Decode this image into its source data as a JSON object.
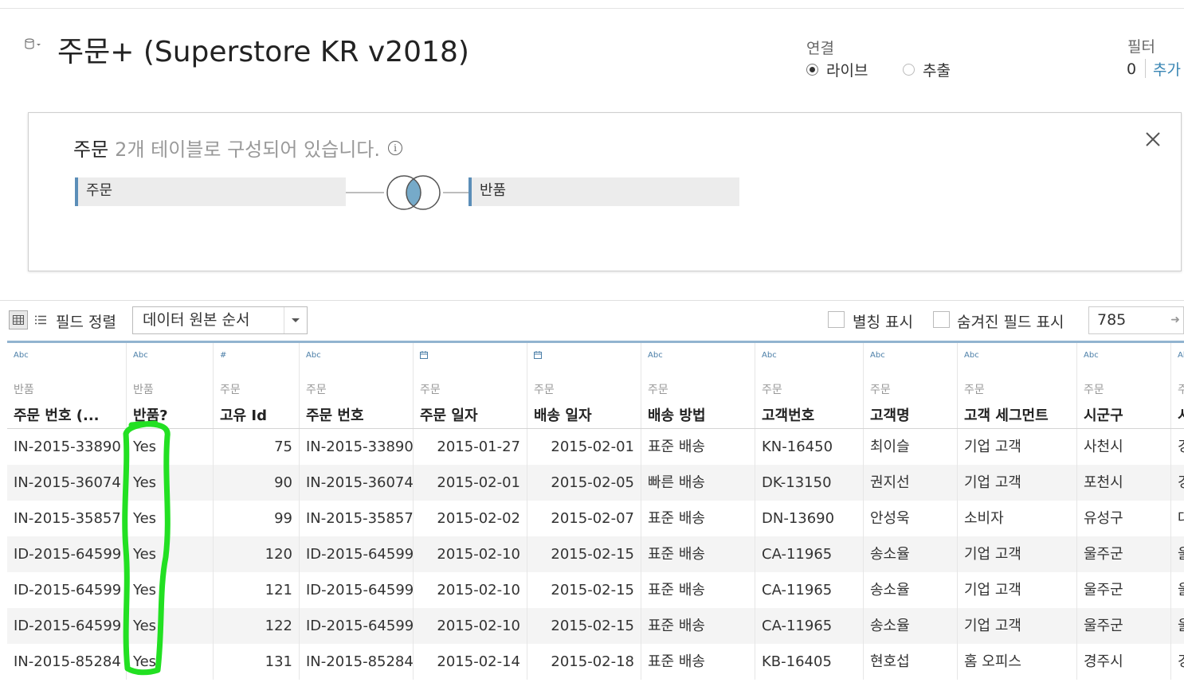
{
  "datasource": {
    "title": "주문+ (Superstore KR v2018)"
  },
  "connection": {
    "label": "연결",
    "live": "라이브",
    "extract": "추출",
    "selected": "live"
  },
  "filters": {
    "label": "필터",
    "count": "0",
    "add": "추가"
  },
  "join_panel": {
    "table_name": "주문",
    "description": "2개 테이블로 구성되어 있습니다.",
    "left_table": "주문",
    "right_table": "반품",
    "join_type": "inner"
  },
  "toolbar": {
    "sort_label": "필드 정렬",
    "sort_value": "데이터 원본 순서",
    "alias_label": "별칭 표시",
    "hidden_label": "숨겨진 필드 표시",
    "row_count": "785"
  },
  "grid": {
    "columns": [
      {
        "type": "Abc",
        "source": "반품",
        "name": "주문 번호 (..."
      },
      {
        "type": "Abc",
        "source": "반품",
        "name": "반품?"
      },
      {
        "type": "#",
        "source": "주문",
        "name": "고유 Id"
      },
      {
        "type": "Abc",
        "source": "주문",
        "name": "주문 번호"
      },
      {
        "type": "date",
        "source": "주문",
        "name": "주문 일자"
      },
      {
        "type": "date",
        "source": "주문",
        "name": "배송 일자"
      },
      {
        "type": "Abc",
        "source": "주문",
        "name": "배송 방법"
      },
      {
        "type": "Abc",
        "source": "주문",
        "name": "고객번호"
      },
      {
        "type": "Abc",
        "source": "주문",
        "name": "고객명"
      },
      {
        "type": "Abc",
        "source": "주문",
        "name": "고객 세그먼트"
      },
      {
        "type": "Abc",
        "source": "주문",
        "name": "시군구"
      },
      {
        "type": "Abc",
        "source": "주",
        "name": "시"
      }
    ],
    "rows": [
      [
        "IN-2015-33890",
        "Yes",
        "75",
        "IN-2015-33890",
        "2015-01-27",
        "2015-02-01",
        "표준 배송",
        "KN-16450",
        "최이슬",
        "기업 고객",
        "사천시",
        "경"
      ],
      [
        "IN-2015-36074",
        "Yes",
        "90",
        "IN-2015-36074",
        "2015-02-01",
        "2015-02-05",
        "빠른 배송",
        "DK-13150",
        "권지선",
        "기업 고객",
        "포천시",
        "경"
      ],
      [
        "IN-2015-35857",
        "Yes",
        "99",
        "IN-2015-35857",
        "2015-02-02",
        "2015-02-07",
        "표준 배송",
        "DN-13690",
        "안성욱",
        "소비자",
        "유성구",
        "대"
      ],
      [
        "ID-2015-64599",
        "Yes",
        "120",
        "ID-2015-64599",
        "2015-02-10",
        "2015-02-15",
        "표준 배송",
        "CA-11965",
        "송소율",
        "기업 고객",
        "울주군",
        "울"
      ],
      [
        "ID-2015-64599",
        "Yes",
        "121",
        "ID-2015-64599",
        "2015-02-10",
        "2015-02-15",
        "표준 배송",
        "CA-11965",
        "송소율",
        "기업 고객",
        "울주군",
        "울"
      ],
      [
        "ID-2015-64599",
        "Yes",
        "122",
        "ID-2015-64599",
        "2015-02-10",
        "2015-02-15",
        "표준 배송",
        "CA-11965",
        "송소율",
        "기업 고객",
        "울주군",
        "울"
      ],
      [
        "IN-2015-85284",
        "Yes",
        "131",
        "IN-2015-85284",
        "2015-02-14",
        "2015-02-18",
        "표준 배송",
        "KB-16405",
        "현호섭",
        "홈 오피스",
        "경주시",
        "경"
      ]
    ]
  },
  "colors": {
    "accent": "#3a86b4",
    "pill_border": "#5b8eb8",
    "venn_fill": "#76aac9",
    "annotation": "#22e022"
  }
}
